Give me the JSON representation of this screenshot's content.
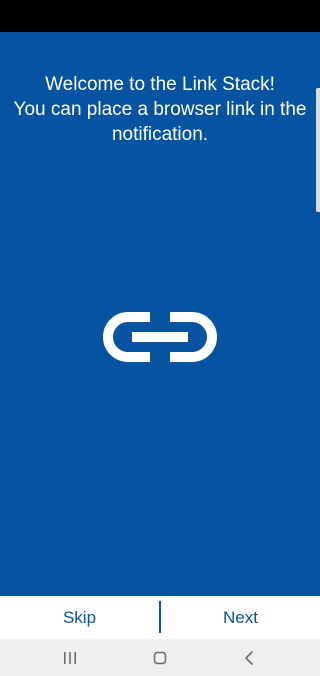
{
  "onboarding": {
    "line1": "Welcome to the Link Stack!",
    "line2": "You can place a browser link in the",
    "line3": "notification.",
    "icon": "link-icon"
  },
  "bottom_bar": {
    "skip_label": "Skip",
    "next_label": "Next"
  },
  "nav_bar": {
    "icons": [
      "recent-apps-icon",
      "home-icon",
      "back-icon"
    ]
  },
  "colors": {
    "primary": "#0654a1",
    "text_light": "#ffffff",
    "nav_background": "#efefef"
  }
}
